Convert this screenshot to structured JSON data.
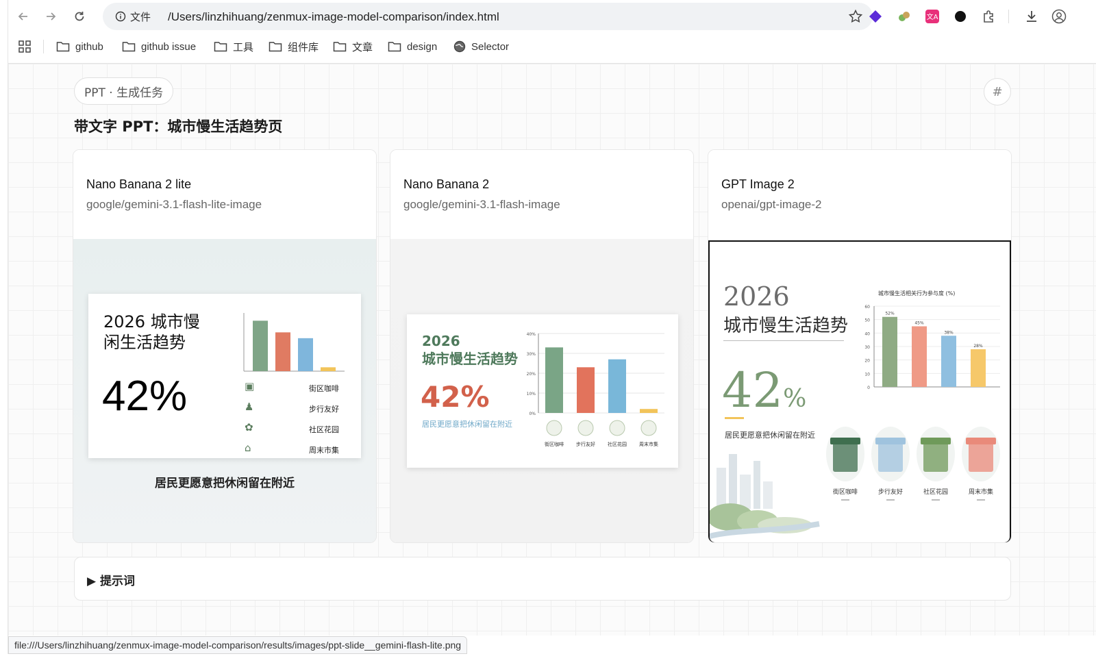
{
  "browser": {
    "info_label": "文件",
    "url": "/Users/linzhihuang/zenmux-image-model-comparison/index.html",
    "bookmarks": [
      {
        "label": "github",
        "icon": "folder-icon"
      },
      {
        "label": "github issue",
        "icon": "folder-icon"
      },
      {
        "label": "工具",
        "icon": "folder-icon"
      },
      {
        "label": "组件库",
        "icon": "folder-icon"
      },
      {
        "label": "文章",
        "icon": "folder-icon"
      },
      {
        "label": "design",
        "icon": "folder-icon"
      },
      {
        "label": "Selector",
        "icon": "globe-icon"
      }
    ],
    "extension_colors": [
      "#5b2bd8",
      "#7ab55c",
      "#e8307a",
      "#111111",
      "#555555"
    ],
    "status_url": "file:///Users/linzhihuang/zenmux-image-model-comparison/results/images/ppt-slide__gemini-flash-lite.png"
  },
  "page": {
    "chip": "PPT · 生成任务",
    "hash": "#",
    "title": "带文字 PPT：城市慢生活趋势页",
    "prompt_toggle": "▶ 提示词"
  },
  "cards": [
    {
      "name": "Nano Banana 2 lite",
      "model_id": "google/gemini-3.1-flash-lite-image",
      "slide": {
        "title_line1": "2026 城市慢",
        "title_line2": "闲生活趋势",
        "big_stat": "42%",
        "legend": [
          "街区咖啡",
          "步行友好",
          "社区花园",
          "周末市集"
        ],
        "caption": "居民更愿意把休闲留在附近"
      }
    },
    {
      "name": "Nano Banana 2",
      "model_id": "google/gemini-3.1-flash-image",
      "slide": {
        "year": "2026",
        "title": "城市慢生活趋势",
        "big_stat": "42%",
        "subtitle": "居民更愿意把休闲留在附近",
        "y_ticks": [
          "40%",
          "30%",
          "20%",
          "10%",
          "0%"
        ],
        "categories": [
          "街区咖啡",
          "步行友好",
          "社区花园",
          "周末市集"
        ]
      }
    },
    {
      "name": "GPT Image 2",
      "model_id": "openai/gpt-image-2",
      "slide": {
        "year": "2026",
        "title": "城市慢生活趋势",
        "big_num": "42",
        "big_unit": "%",
        "subtitle": "居民更愿意把休闲留在附近",
        "chart_title": "城市慢生活相关行为参与度 (%)",
        "y_ticks": [
          "60",
          "50",
          "40",
          "30",
          "20",
          "10",
          "0"
        ],
        "value_labels": [
          "52%",
          "45%",
          "38%",
          "28%"
        ],
        "categories": [
          "街区咖啡",
          "步行友好",
          "社区花园",
          "周末市集"
        ]
      }
    }
  ],
  "chart_data": [
    {
      "type": "bar",
      "categories": [
        "街区咖啡",
        "步行友好",
        "社区花园",
        "周末市集"
      ],
      "values": [
        0.52,
        0.4,
        0.34,
        0.04
      ],
      "colors": [
        "#7fa587",
        "#e07b62",
        "#7fb6dc",
        "#f2c45a"
      ]
    },
    {
      "type": "bar",
      "categories": [
        "街区咖啡",
        "步行友好",
        "社区花园",
        "周末市集"
      ],
      "values": [
        33,
        23,
        27,
        2
      ],
      "ylim": [
        0,
        40
      ],
      "colors": [
        "#7aa586",
        "#e2735c",
        "#79b7d9",
        "#f2c45a"
      ]
    },
    {
      "type": "bar",
      "title": "城市慢生活相关行为参与度 (%)",
      "categories": [
        "街区咖啡",
        "步行友好",
        "社区花园",
        "周末市集"
      ],
      "values": [
        52,
        45,
        38,
        28
      ],
      "ylim": [
        0,
        60
      ],
      "colors": [
        "#8fab84",
        "#ef9a86",
        "#8fbfe0",
        "#f6c86a"
      ]
    }
  ]
}
